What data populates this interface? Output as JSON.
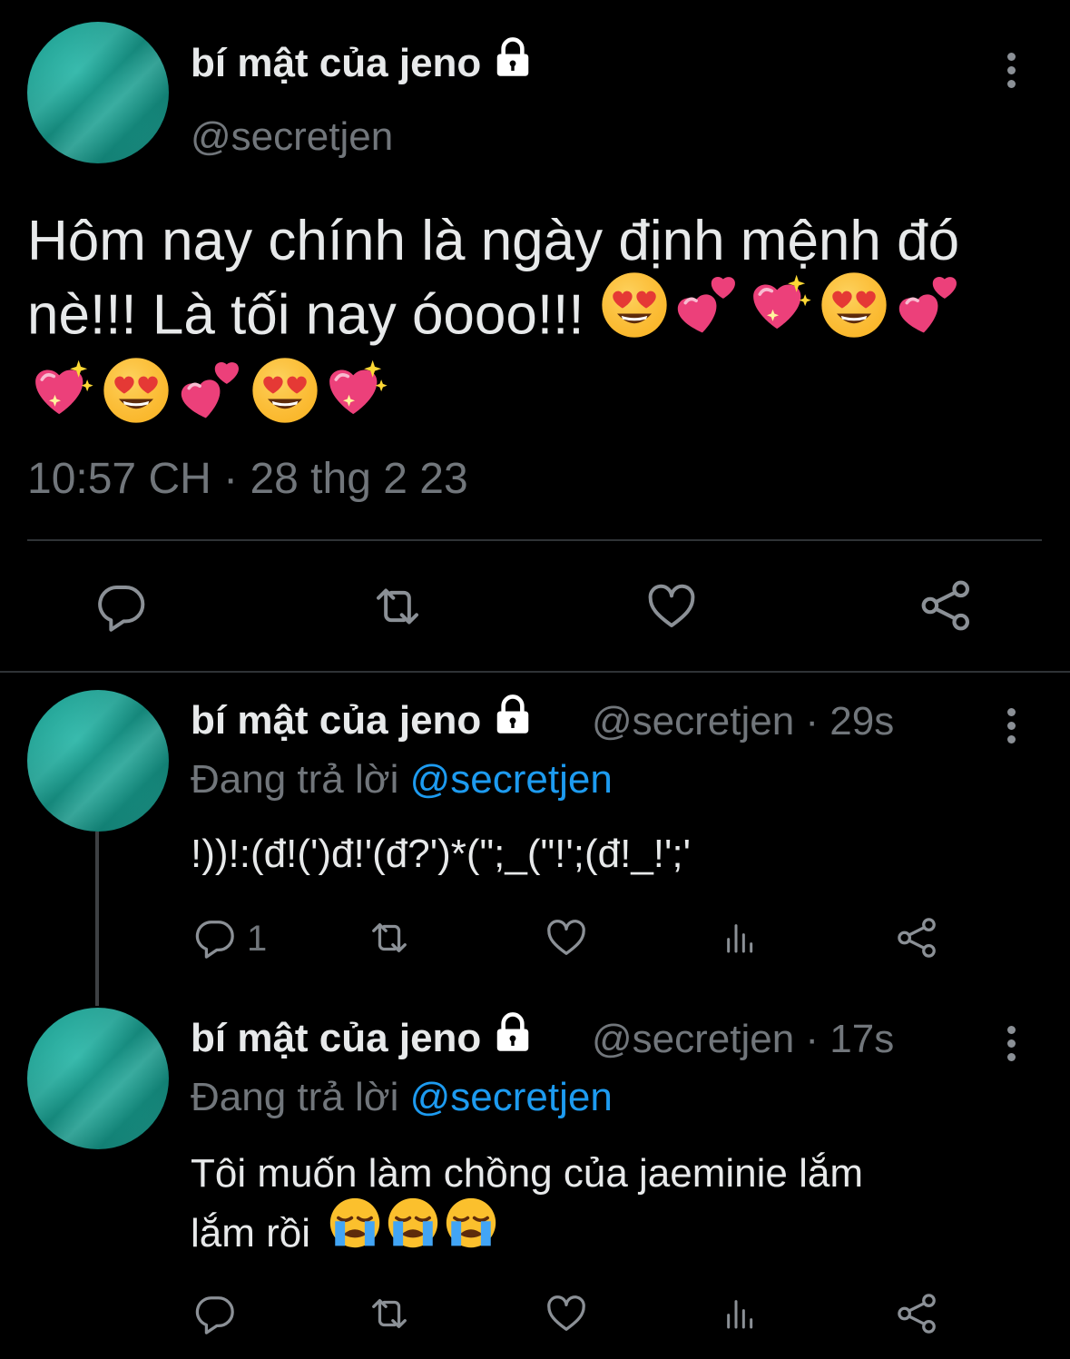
{
  "main_tweet": {
    "display_name": "bí mật của jeno",
    "handle": "@secretjen",
    "text": "Hôm nay chính là ngày định mệnh đó nè!!! Là tối nay óooo!!!",
    "emojis": [
      "smiling-face-with-heart-eyes",
      "two-hearts",
      "sparkling-heart",
      "smiling-face-with-heart-eyes",
      "two-hearts",
      "sparkling-heart",
      "smiling-face-with-heart-eyes",
      "two-hearts",
      "smiling-face-with-heart-eyes",
      "sparkling-heart"
    ],
    "timestamp": "10:57 CH · 28 thg 2 23",
    "actions": [
      "reply-icon",
      "retweet-icon",
      "like-icon",
      "share-icon"
    ]
  },
  "replies": [
    {
      "display_name": "bí mật của jeno",
      "meta": "@secretjen · 29s",
      "replying_prefix": "Đang trả lời",
      "replying_to": "@secretjen",
      "text": "!))!:(đ!(')đ!'(đ?')*(\";_(\"!';(đ!_!';'",
      "reply_count": "1",
      "actions": [
        "reply-icon",
        "retweet-icon",
        "like-icon",
        "views-icon",
        "share-icon"
      ]
    },
    {
      "display_name": "bí mật của jeno",
      "meta": "@secretjen · 17s",
      "replying_prefix": "Đang trả lời",
      "replying_to": "@secretjen",
      "text_line1": "Tôi muốn làm chồng của jaeminie lắm",
      "text_line2": "lắm rồi",
      "emojis": [
        "loudly-crying-face",
        "loudly-crying-face",
        "loudly-crying-face"
      ],
      "actions": [
        "reply-icon",
        "retweet-icon",
        "like-icon",
        "views-icon",
        "share-icon"
      ]
    }
  ],
  "colors": {
    "background": "#000000",
    "text": "#e7e9ea",
    "secondary": "#71767b",
    "link": "#1d9bf0",
    "avatar": "#17988a"
  }
}
